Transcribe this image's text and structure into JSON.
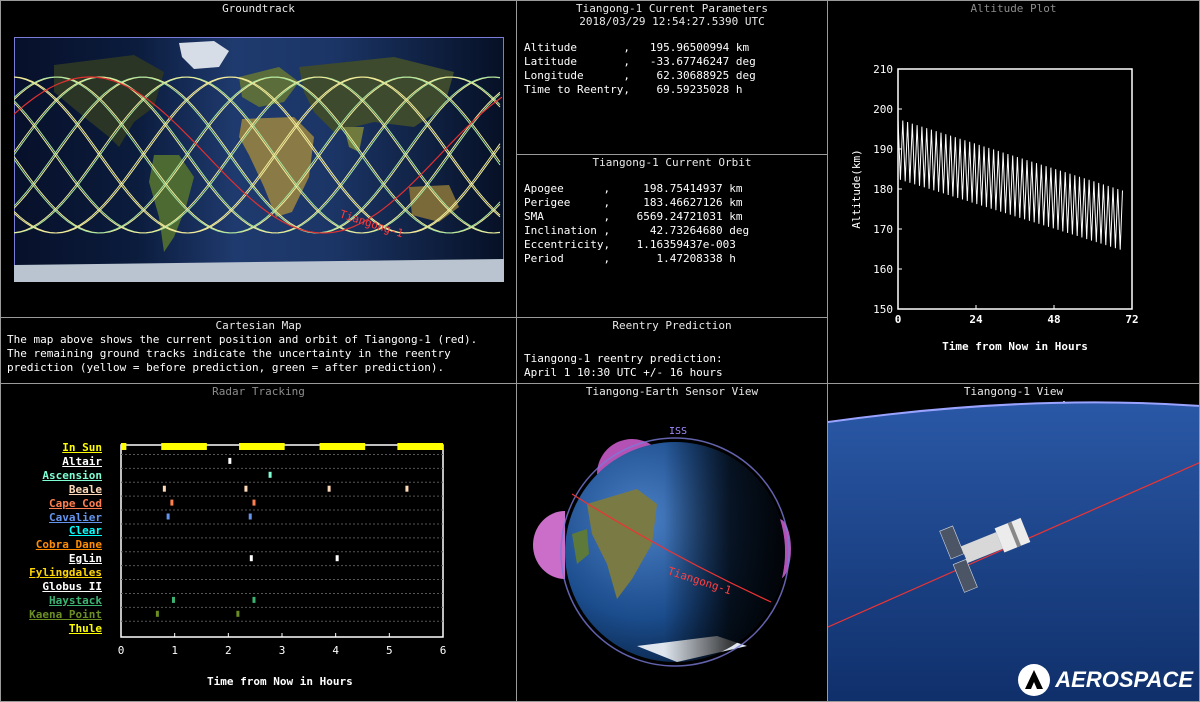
{
  "groundtrack": {
    "title": "Groundtrack",
    "sat_label": "Tiangong-1"
  },
  "current_params": {
    "title": "Tiangong-1 Current Parameters",
    "timestamp": "2018/03/29 12:54:27.5390 UTC",
    "rows": [
      {
        "label": "Altitude       ,",
        "value": "195.96500994 km"
      },
      {
        "label": "Latitude       ,",
        "value": "-33.67746247 deg"
      },
      {
        "label": "Longitude      ,",
        "value": " 62.30688925 deg"
      },
      {
        "label": "Time to Reentry,",
        "value": " 69.59235028 h"
      }
    ]
  },
  "current_orbit": {
    "title": "Tiangong-1 Current Orbit",
    "rows": [
      {
        "label": "Apogee      ,",
        "value": "  198.75414937 km"
      },
      {
        "label": "Perigee     ,",
        "value": "  183.46627126 km"
      },
      {
        "label": "SMA         ,",
        "value": " 6569.24721031 km"
      },
      {
        "label": "Inclination ,",
        "value": "   42.73264680 deg"
      },
      {
        "label": "Eccentricity,",
        "value": " 1.16359437e-003"
      },
      {
        "label": "Period      ,",
        "value": "    1.47208338 h"
      }
    ]
  },
  "altitude_plot": {
    "title": "Altitude Plot",
    "ylabel": "Altitude(km)",
    "xlabel": "Time from Now in Hours",
    "yticks": [
      "210",
      "200",
      "190",
      "180",
      "170",
      "160",
      "150"
    ],
    "xticks": [
      "0",
      "24",
      "48",
      "72"
    ]
  },
  "cartesian_map": {
    "title": "Cartesian Map",
    "lines": [
      "The map above shows the current position and orbit of Tiangong-1 (red).",
      "The remaining ground tracks indicate the uncertainty in the reentry",
      "prediction (yellow = before prediction, green = after prediction)."
    ]
  },
  "reentry": {
    "title": "Reentry Prediction",
    "line1": "Tiangong-1 reentry prediction:",
    "line2": "April 1 10:30 UTC +/- 16 hours"
  },
  "radar": {
    "title": "Radar Tracking",
    "xlabel": "Time from Now in Hours",
    "xticks": [
      "0",
      "1",
      "2",
      "3",
      "4",
      "5",
      "6"
    ],
    "stations": [
      {
        "name": "In Sun",
        "color": "#ffff00"
      },
      {
        "name": "Altair",
        "color": "#ffffff"
      },
      {
        "name": "Ascension",
        "color": "#7fffd4"
      },
      {
        "name": "Beale",
        "color": "#ffdab9"
      },
      {
        "name": "Cape Cod",
        "color": "#ff7f50"
      },
      {
        "name": "Cavalier",
        "color": "#6495ed"
      },
      {
        "name": "Clear",
        "color": "#00ffff"
      },
      {
        "name": "Cobra Dane",
        "color": "#ff8c00"
      },
      {
        "name": "Eglin",
        "color": "#ffffff"
      },
      {
        "name": "Fylingdales",
        "color": "#ffd700"
      },
      {
        "name": "Globus II",
        "color": "#ffffff"
      },
      {
        "name": "Haystack",
        "color": "#3cb371"
      },
      {
        "name": "Kaena Point",
        "color": "#6b8e23"
      },
      {
        "name": "Thule",
        "color": "#ffff00"
      }
    ]
  },
  "sensor_view": {
    "title": "Tiangong-Earth Sensor View",
    "sat_label": "Tiangong-1",
    "iss_label": "ISS"
  },
  "sat_view": {
    "title": "Tiangong-1 View"
  },
  "logo": {
    "text": "AEROSPACE"
  }
}
